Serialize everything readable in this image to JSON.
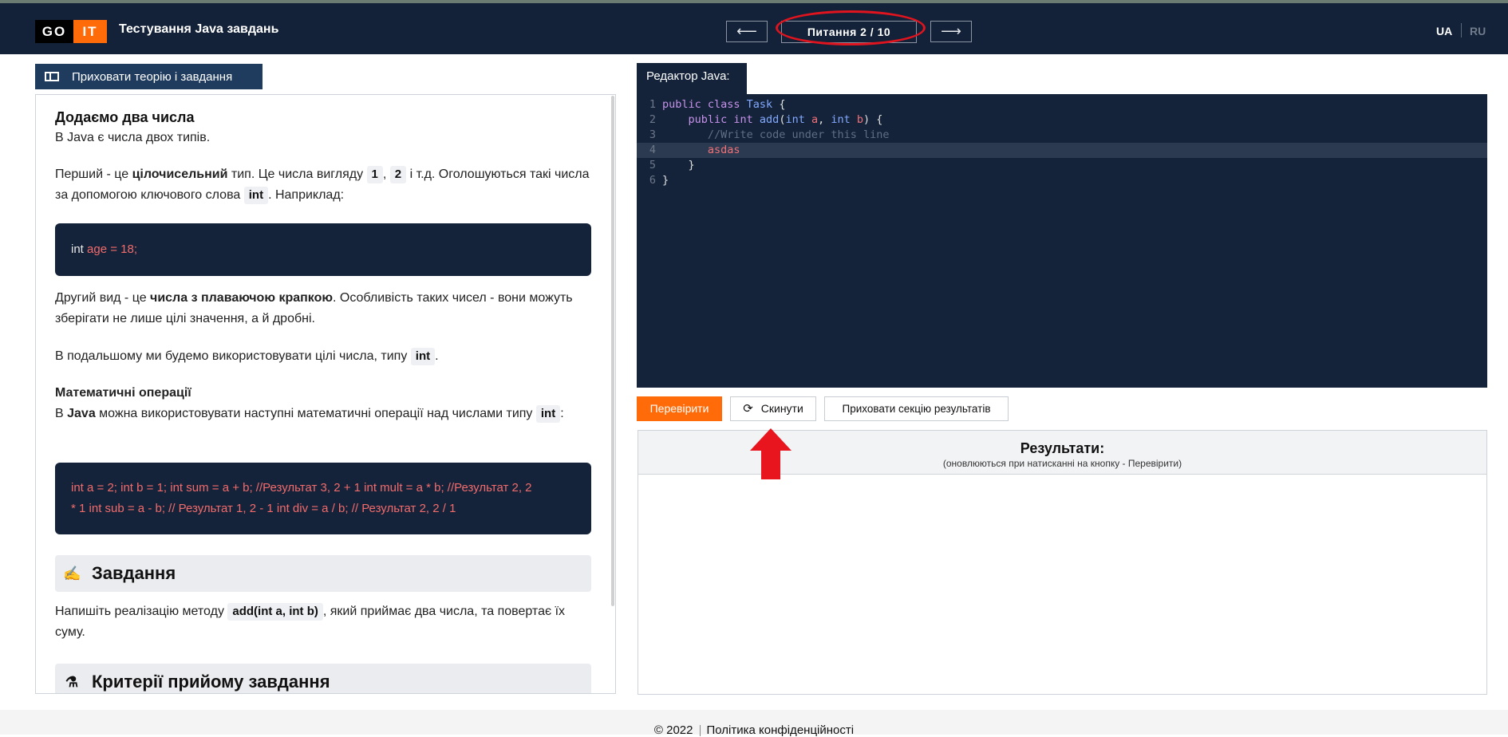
{
  "header": {
    "logo_go": "GO",
    "logo_it": "IT",
    "app_title": "Тестування Java завдань",
    "prev_arrow": "⟵",
    "next_arrow": "⟶",
    "question_counter": "Питання 2 / 10",
    "lang_ua": "UA",
    "lang_ru": "RU"
  },
  "toolbar": {
    "hide_theory_label": "Приховати теорію і завдання"
  },
  "theory": {
    "title": "Додаємо два числа",
    "intro": "В Java є числа двох типів.",
    "p1_a": "Перший - це ",
    "p1_bold": "цілочисельний",
    "p1_b": " тип. Це числа вигляду ",
    "p1_chip1": "1",
    "p1_comma": ", ",
    "p1_chip2": "2",
    "p1_c": " і т.д. Оголошуються такі числа за допомогою ключового слова ",
    "p1_chip3": "int",
    "p1_d": ". Наприклад:",
    "code1_kw": "int",
    "code1_rest": " age = 18;",
    "p2_a": "Другий вид - це ",
    "p2_bold": "числа з плаваючою крапкою",
    "p2_b": ". Особливість таких чисел - вони можуть зберігати не лише цілі значення, а й дробні.",
    "p3_a": "В подальшому ми будемо використовувати цілі числа, типу ",
    "p3_chip": "int",
    "p3_b": ".",
    "ops_title": "Математичні операції",
    "ops_a": "В ",
    "ops_bold": "Java",
    "ops_b": " можна використовувати наступні математичні операції над числами типу ",
    "ops_chip": "int",
    "ops_c": ":",
    "code2_line1": "int a = 2; int b = 1; int sum = a + b; //Результат 3, 2 + 1 int mult = a * b; //Результат 2, 2",
    "code2_line2": "* 1 int sub = a - b; // Результат 1, 2 - 1 int div = a / b; // Результат 2, 2 / 1",
    "task_heading": "Завдання",
    "task_a": "Напишіть реалізацію методу ",
    "task_chip": "add(int a, int b)",
    "task_b": ", який приймає два числа, та повертає їх суму.",
    "criteria_heading": "Критерії прийому завдання"
  },
  "editor": {
    "tab_label": "Редактор Java:",
    "lines": [
      {
        "num": "1",
        "text": "public class Task {"
      },
      {
        "num": "2",
        "text": "    public int add(int a, int b) {"
      },
      {
        "num": "3",
        "text": "       //Write code under this line"
      },
      {
        "num": "4",
        "text": "       asdas"
      },
      {
        "num": "5",
        "text": "    }"
      },
      {
        "num": "6",
        "text": "}"
      }
    ]
  },
  "actions": {
    "check_label": "Перевірити",
    "reset_label": "Скинути",
    "hide_results_label": "Приховати секцію результатів"
  },
  "results": {
    "title": "Результати:",
    "subtitle": "(оновлюються при натисканні на кнопку - Перевірити)"
  },
  "footer": {
    "copyright": "© 2022",
    "privacy": "Політика конфіденційності"
  },
  "colors": {
    "header_bg": "#132238",
    "accent_orange": "#ff6b08",
    "editor_bg": "#14233a",
    "annotation_red": "#e0141e"
  }
}
